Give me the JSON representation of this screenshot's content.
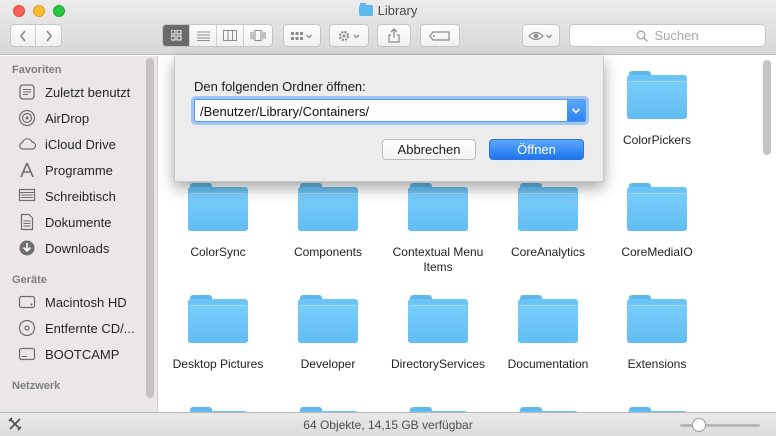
{
  "window": {
    "title": "Library"
  },
  "toolbar": {
    "back_icon": "chevron-left-icon",
    "forward_icon": "chevron-right-icon",
    "view_modes": [
      "icon-view",
      "list-view",
      "column-view",
      "cover-flow-view"
    ],
    "active_view": "icon-view",
    "search_placeholder": "Suchen"
  },
  "sidebar": {
    "sections": [
      {
        "heading": "Favoriten",
        "items": [
          {
            "label": "Zuletzt benutzt",
            "icon": "recents-icon"
          },
          {
            "label": "AirDrop",
            "icon": "airdrop-icon"
          },
          {
            "label": "iCloud Drive",
            "icon": "cloud-icon"
          },
          {
            "label": "Programme",
            "icon": "applications-icon"
          },
          {
            "label": "Schreibtisch",
            "icon": "desktop-icon"
          },
          {
            "label": "Dokumente",
            "icon": "documents-icon"
          },
          {
            "label": "Downloads",
            "icon": "downloads-icon"
          }
        ]
      },
      {
        "heading": "Geräte",
        "items": [
          {
            "label": "Macintosh HD",
            "icon": "hard-drive-icon"
          },
          {
            "label": "Entfernte CD/...",
            "icon": "remote-disc-icon"
          },
          {
            "label": "BOOTCAMP",
            "icon": "disk-icon"
          }
        ]
      },
      {
        "heading": "Netzwerk",
        "items": []
      }
    ]
  },
  "folders": [
    "ColorPickers",
    "ColorSync",
    "Components",
    "Contextual Menu Items",
    "CoreAnalytics",
    "CoreMediaIO",
    "Desktop Pictures",
    "Developer",
    "DirectoryServices",
    "Documentation",
    "Extensions"
  ],
  "status": {
    "text": "64 Objekte, 14,15 GB verfügbar"
  },
  "dialog": {
    "prompt": "Den folgenden Ordner öffnen:",
    "path_value": "/Benutzer/Library/Containers/",
    "cancel_label": "Abbrechen",
    "open_label": "Öffnen"
  },
  "colors": {
    "accent": "#2f82f4",
    "folder": "#6cc4f5",
    "sidebar_bg": "#ebe7e9"
  }
}
